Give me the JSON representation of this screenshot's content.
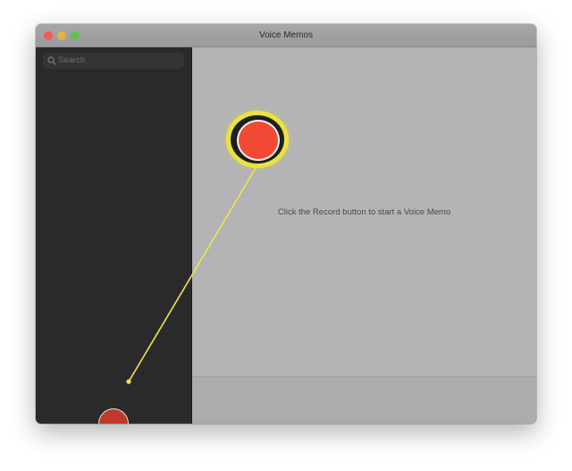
{
  "window": {
    "title": "Voice Memos"
  },
  "sidebar": {
    "search_placeholder": "Search",
    "record_icon": "record-circle-icon"
  },
  "main": {
    "empty_message": "Click the Record button to start a Voice Memo",
    "record_icon": "record-circle-icon"
  },
  "colors": {
    "record_red": "#f24a35",
    "highlight_yellow": "#ebe33d",
    "sidebar_bg": "#2b2a2b",
    "main_bg": "#b4b4b6"
  }
}
